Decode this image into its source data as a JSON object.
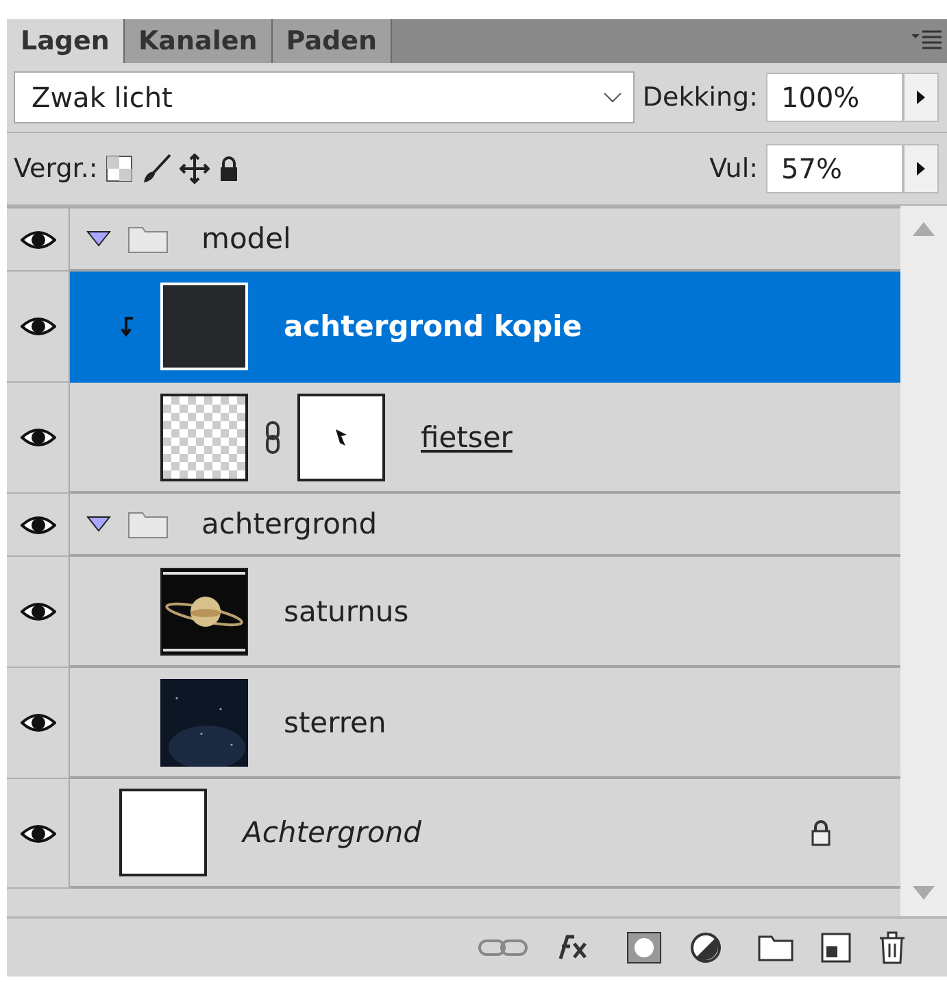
{
  "tabs": [
    {
      "label": "Lagen",
      "selected": true
    },
    {
      "label": "Kanalen",
      "selected": false
    },
    {
      "label": "Paden",
      "selected": false
    }
  ],
  "blend_mode": {
    "value": "Zwak licht"
  },
  "opacity": {
    "label": "Dekking:",
    "value": "100%"
  },
  "lock": {
    "label": "Vergr.:"
  },
  "fill": {
    "label": "Vul:",
    "value": "57%"
  },
  "layers": [
    {
      "kind": "group",
      "name": "model",
      "visible": true,
      "selected": false,
      "expanded": true,
      "children": [
        {
          "kind": "layer",
          "name": "achtergrond kopie",
          "visible": true,
          "selected": true,
          "clipped": true,
          "thumb": {
            "kind": "dark"
          }
        },
        {
          "kind": "masked",
          "name": "fietser",
          "visible": true,
          "selected": false,
          "underlined": true,
          "thumb": {
            "kind": "transparent"
          }
        }
      ]
    },
    {
      "kind": "group",
      "name": "achtergrond",
      "visible": true,
      "selected": false,
      "expanded": true,
      "children": [
        {
          "kind": "layer",
          "name": "saturnus",
          "visible": true,
          "selected": false,
          "thumb": {
            "kind": "planet"
          }
        },
        {
          "kind": "layer",
          "name": "sterren",
          "visible": true,
          "selected": false,
          "thumb": {
            "kind": "stars"
          }
        }
      ]
    },
    {
      "kind": "layer",
      "name": "Achtergrond",
      "visible": true,
      "selected": false,
      "locked": true,
      "thumb": {
        "kind": "white"
      }
    }
  ]
}
